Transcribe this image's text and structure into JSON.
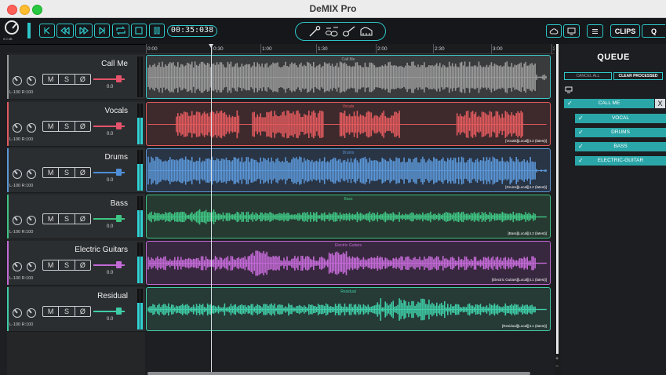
{
  "window": {
    "title": "DeMIX Pro"
  },
  "toolbar": {
    "knob_caption": "0.0 dB",
    "time": "00:35:038",
    "clips_label": "CLIPS",
    "search_label": "Q"
  },
  "timeline": {
    "ticks": [
      "0:00",
      "0:30",
      "1:00",
      "1:30",
      "2:00",
      "2:30",
      "3:00",
      "3"
    ]
  },
  "tracks": [
    {
      "name": "Call Me",
      "color": "#9a9a9a",
      "lane_bg": "#3a3b3d",
      "border": "#3ec8c8",
      "label": "Call Me",
      "tag": "",
      "pan": "L-100 R:100",
      "fader": "0.0",
      "fader_color": "#e4536b"
    },
    {
      "name": "Vocals",
      "color": "#e05a5d",
      "lane_bg": "#3e2a2d",
      "border": "#e05a5d",
      "label": "Vocals",
      "tag": "[Vocals][Local][4.2 (latest)]",
      "pan": "L-100 R:100",
      "fader": "0.0",
      "fader_color": "#e4536b"
    },
    {
      "name": "Drums",
      "color": "#5b96d6",
      "lane_bg": "#293445",
      "border": "#5b96d6",
      "label": "Drums",
      "tag": "[Drums][Local][4.2 (latest)]",
      "pan": "L-100 R:100",
      "fader": "0.0",
      "fader_color": "#4f8fd8"
    },
    {
      "name": "Bass",
      "color": "#3fc483",
      "lane_bg": "#263a31",
      "border": "#3fc483",
      "label": "Bass",
      "tag": "[Bass][Local][4.2 (latest)]",
      "pan": "L-100 R:100",
      "fader": "0.0",
      "fader_color": "#3fc483"
    },
    {
      "name": "Electric Guitars",
      "color": "#c36ad6",
      "lane_bg": "#38283f",
      "border": "#c36ad6",
      "label": "Electric Guitars",
      "tag": "[Electric Guitars][Local][4.1 (latest)]",
      "pan": "L-100 R:100",
      "fader": "0.0",
      "fader_color": "#c36ad6"
    },
    {
      "name": "Residual",
      "color": "#3fcda7",
      "lane_bg": "#263a36",
      "border": "#3fcda7",
      "label": "Residual",
      "tag": "[Residual][Local][4.1 (latest)]",
      "pan": "L-100 R:100",
      "fader": "0.0",
      "fader_color": "#3fcda7"
    }
  ],
  "mixer_buttons": {
    "mute": "M",
    "solo": "S",
    "phase": "Ø"
  },
  "queue": {
    "title": "QUEUE",
    "cancel_all": "CANCEL ALL",
    "clear_processed": "CLEAR PROCESSED",
    "job": "CALL ME",
    "close": "X",
    "items": [
      "VOCAL",
      "DRUMS",
      "BASS",
      "ELECTRIC-GUITAR"
    ]
  },
  "colors": {
    "accent": "#2fc7c9"
  }
}
